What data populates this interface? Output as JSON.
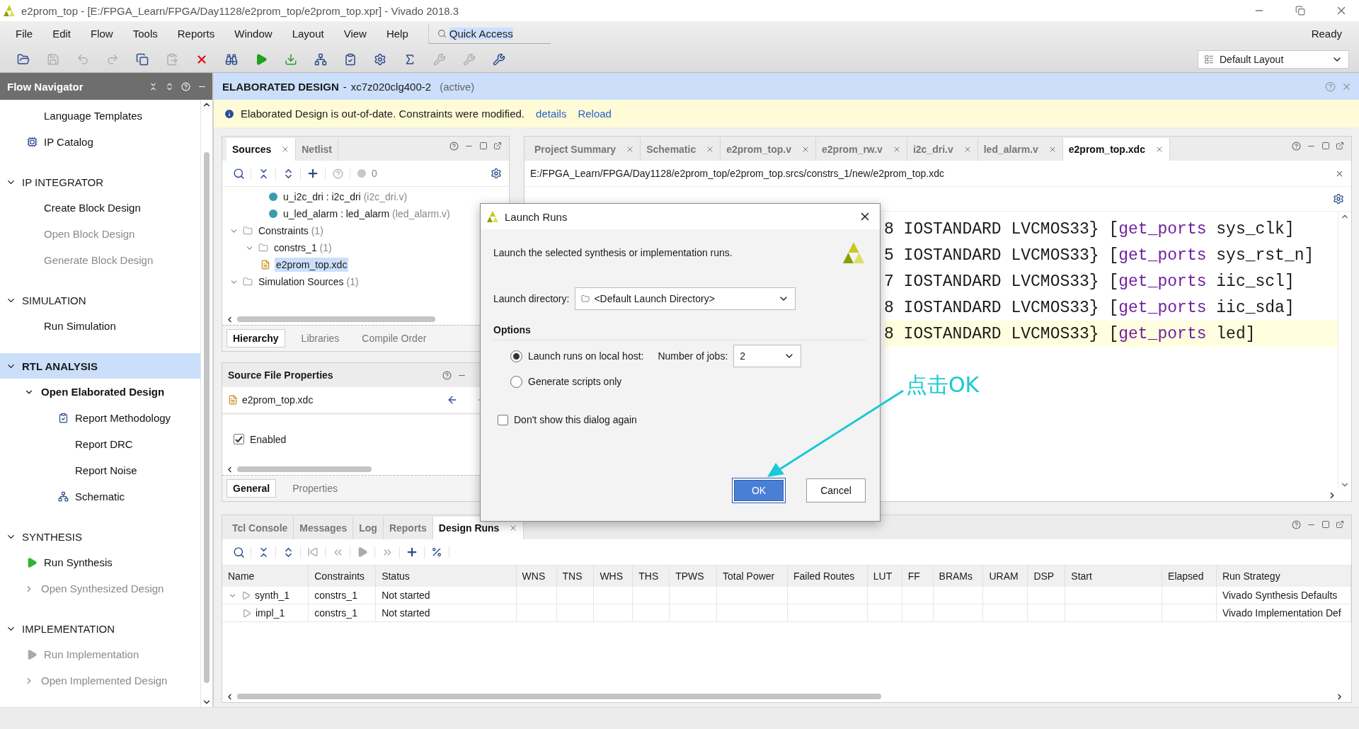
{
  "window": {
    "title": "e2prom_top - [E:/FPGA_Learn/FPGA/Day1128/e2prom_top/e2prom_top.xpr] - Vivado 2018.3"
  },
  "menu": [
    "File",
    "Edit",
    "Flow",
    "Tools",
    "Reports",
    "Window",
    "Layout",
    "View",
    "Help"
  ],
  "quick_access": {
    "value": "Quick Access"
  },
  "status": "Ready",
  "toolbar": [
    {
      "kind": "open",
      "disabled": false
    },
    {
      "kind": "save",
      "disabled": true
    },
    {
      "kind": "undo",
      "disabled": true
    },
    {
      "kind": "redo",
      "disabled": true
    },
    {
      "kind": "copy",
      "disabled": false
    },
    {
      "kind": "paste",
      "disabled": true
    },
    {
      "kind": "delete",
      "disabled": false
    },
    {
      "kind": "find",
      "disabled": false
    },
    {
      "kind": "run",
      "disabled": false
    },
    {
      "kind": "bitstream",
      "disabled": false
    },
    {
      "kind": "schematic",
      "disabled": false
    },
    {
      "kind": "report",
      "disabled": false
    },
    {
      "kind": "settings",
      "disabled": false
    },
    {
      "kind": "sigma",
      "disabled": false
    },
    {
      "kind": "tool",
      "disabled": true
    },
    {
      "kind": "tool",
      "disabled": true
    },
    {
      "kind": "tool",
      "disabled": false
    }
  ],
  "layout_select": {
    "value": "Default Layout"
  },
  "flow_navigator": {
    "title": "Flow Navigator",
    "sections": [
      {
        "items": [
          {
            "label": "Language Templates",
            "kind": "plain",
            "disabled": false
          },
          {
            "label": "IP Catalog",
            "kind": "ip",
            "disabled": false
          }
        ]
      },
      {
        "label": "IP INTEGRATOR",
        "selected": false,
        "expanded": true,
        "items": [
          {
            "label": "Create Block Design",
            "kind": "plain",
            "disabled": false
          },
          {
            "label": "Open Block Design",
            "kind": "plain",
            "disabled": true
          },
          {
            "label": "Generate Block Design",
            "kind": "plain",
            "disabled": true
          }
        ]
      },
      {
        "label": "SIMULATION",
        "selected": false,
        "expanded": true,
        "items": [
          {
            "label": "Run Simulation",
            "kind": "plain",
            "disabled": false
          }
        ]
      },
      {
        "label": "RTL ANALYSIS",
        "selected": true,
        "expanded": true,
        "items": [
          {
            "label": "Open Elaborated Design",
            "kind": "group",
            "disabled": false,
            "expanded": true,
            "children": [
              {
                "label": "Report Methodology",
                "kind": "report",
                "disabled": false
              },
              {
                "label": "Report DRC",
                "kind": "plain",
                "disabled": false
              },
              {
                "label": "Report Noise",
                "kind": "plain",
                "disabled": false
              },
              {
                "label": "Schematic",
                "kind": "schematic",
                "disabled": false
              }
            ]
          }
        ]
      },
      {
        "label": "SYNTHESIS",
        "selected": false,
        "expanded": true,
        "items": [
          {
            "label": "Run Synthesis",
            "kind": "run",
            "disabled": false
          },
          {
            "label": "Open Synthesized Design",
            "kind": "group",
            "disabled": true,
            "expanded": false
          }
        ]
      },
      {
        "label": "IMPLEMENTATION",
        "selected": false,
        "expanded": true,
        "items": [
          {
            "label": "Run Implementation",
            "kind": "run",
            "disabled": true
          },
          {
            "label": "Open Implemented Design",
            "kind": "group",
            "disabled": true,
            "expanded": false
          }
        ]
      }
    ]
  },
  "design_header": {
    "title": "ELABORATED DESIGN",
    "separator": "-",
    "part": "xc7z020clg400-2",
    "state": "(active)"
  },
  "notice": {
    "text": "Elaborated Design is out-of-date. Constraints were modified.",
    "links": [
      "details",
      "Reload"
    ]
  },
  "sources": {
    "tabs": [
      {
        "label": "Sources",
        "selected": true
      },
      {
        "label": "Netlist",
        "selected": false
      }
    ],
    "count": "0",
    "tree": [
      {
        "label": "u_i2c_dri : i2c_dri",
        "note": "(i2c_dri.v)",
        "kind": "module",
        "selected": false
      },
      {
        "label": "u_led_alarm : led_alarm",
        "note": "(led_alarm.v)",
        "kind": "module",
        "selected": false
      },
      {
        "label": "Constraints",
        "note": "(1)",
        "kind": "folder",
        "expanded": true,
        "selected": false,
        "children": [
          {
            "label": "constrs_1",
            "note": "(1)",
            "kind": "folder",
            "expanded": true,
            "selected": false,
            "children": [
              {
                "label": "e2prom_top.xdc",
                "kind": "file",
                "selected": true
              }
            ]
          }
        ]
      },
      {
        "label": "Simulation Sources",
        "note": "(1)",
        "kind": "folder",
        "expanded": true,
        "selected": false
      }
    ],
    "subtabs": [
      {
        "label": "Hierarchy",
        "selected": true
      },
      {
        "label": "Libraries",
        "selected": false
      },
      {
        "label": "Compile Order",
        "selected": false
      }
    ]
  },
  "file_properties": {
    "title": "Source File Properties",
    "file": "e2prom_top.xdc",
    "enabled": {
      "label": "Enabled",
      "checked": true
    },
    "subtabs": [
      {
        "label": "General",
        "selected": true
      },
      {
        "label": "Properties",
        "selected": false
      }
    ]
  },
  "editor": {
    "tabs": [
      {
        "label": "Project Summary",
        "selected": false
      },
      {
        "label": "Schematic",
        "selected": false
      },
      {
        "label": "e2prom_top.v",
        "selected": false
      },
      {
        "label": "e2prom_rw.v",
        "selected": false
      },
      {
        "label": "i2c_dri.v",
        "selected": false
      },
      {
        "label": "led_alarm.v",
        "selected": false
      },
      {
        "label": "e2prom_top.xdc",
        "selected": true
      }
    ],
    "path": "E:/FPGA_Learn/FPGA/Day1128/e2prom_top/e2prom_top.srcs/constrs_1/new/e2prom_top.xdc",
    "lines": [
      {
        "head": "8 IOSTANDARD LVCMOS33} [",
        "command": "get_ports",
        "tail": " sys_clk]",
        "highlighted": false
      },
      {
        "head": "5 IOSTANDARD LVCMOS33} [",
        "command": "get_ports",
        "tail": " sys_rst_n]",
        "highlighted": false
      },
      {
        "head": "7 IOSTANDARD LVCMOS33} [",
        "command": "get_ports",
        "tail": " iic_scl]",
        "highlighted": false
      },
      {
        "head": "8 IOSTANDARD LVCMOS33} [",
        "command": "get_ports",
        "tail": " iic_sda]",
        "highlighted": false
      },
      {
        "head": "8 IOSTANDARD LVCMOS33} [",
        "command": "get_ports",
        "tail": " led]",
        "highlighted": true
      }
    ]
  },
  "runs": {
    "tabs": [
      {
        "label": "Tcl Console",
        "selected": false
      },
      {
        "label": "Messages",
        "selected": false
      },
      {
        "label": "Log",
        "selected": false
      },
      {
        "label": "Reports",
        "selected": false
      },
      {
        "label": "Design Runs",
        "selected": true
      }
    ],
    "columns": [
      "Name",
      "Constraints",
      "Status",
      "WNS",
      "TNS",
      "WHS",
      "THS",
      "TPWS",
      "Total Power",
      "Failed Routes",
      "LUT",
      "FF",
      "BRAMs",
      "URAM",
      "DSP",
      "Start",
      "Elapsed",
      "Run Strategy"
    ],
    "rows": [
      {
        "name": "synth_1",
        "constraints": "constrs_1",
        "status": "Not started",
        "strategy": "Vivado Synthesis Defaults",
        "expanded": true,
        "children": [
          {
            "name": "impl_1",
            "constraints": "constrs_1",
            "status": "Not started",
            "strategy": "Vivado Implementation Def"
          }
        ]
      }
    ]
  },
  "dialog": {
    "title": "Launch Runs",
    "description": "Launch the selected synthesis or implementation runs.",
    "directory_label": "Launch directory:",
    "directory": "<Default Launch Directory>",
    "options_title": "Options",
    "options": [
      {
        "label": "Launch runs on local host:",
        "selected": true,
        "jobs_label": "Number of jobs:",
        "jobs": "2"
      },
      {
        "label": "Generate scripts only",
        "selected": false
      }
    ],
    "dont_show": {
      "label": "Don't show this dialog again",
      "checked": false
    },
    "buttons": [
      {
        "label": "OK",
        "primary": true
      },
      {
        "label": "Cancel",
        "primary": false
      }
    ]
  },
  "annotation": {
    "text": "点击OK"
  }
}
